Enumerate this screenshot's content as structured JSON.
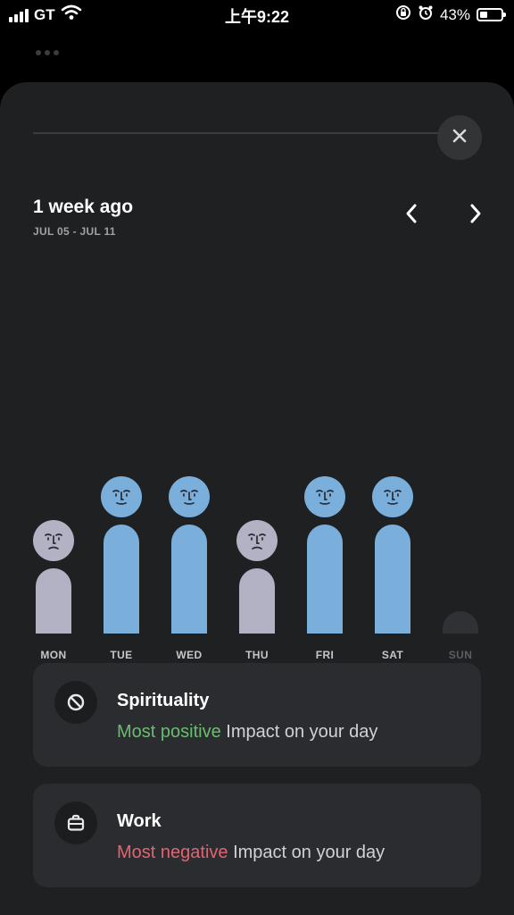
{
  "status_bar": {
    "carrier": "GT",
    "time": "上午9:22",
    "battery_percent": "43%",
    "battery_level": 0.43
  },
  "header": {
    "title": "1 week ago",
    "date_range": "JUL 05 - JUL 11"
  },
  "colors": {
    "positive_bar": "#7aaedb",
    "neutral_bar": "#b3b1c4",
    "empty_bar": "#2f3134",
    "positive_text": "#6abd6f",
    "negative_text": "#e06572"
  },
  "days": [
    {
      "label": "MON",
      "mood": "sad",
      "level": 0.6
    },
    {
      "label": "TUE",
      "mood": "happy",
      "level": 1.0
    },
    {
      "label": "WED",
      "mood": "happy",
      "level": 1.0
    },
    {
      "label": "THU",
      "mood": "sad",
      "level": 0.6
    },
    {
      "label": "FRI",
      "mood": "happy",
      "level": 1.0
    },
    {
      "label": "SAT",
      "mood": "happy",
      "level": 1.0
    },
    {
      "label": "SUN",
      "mood": "none",
      "level": 0.0
    }
  ],
  "impacts": [
    {
      "title": "Spirituality",
      "highlight": "Most positive",
      "rest": " Impact on your day",
      "icon": "spirituality-icon",
      "tone": "positive"
    },
    {
      "title": "Work",
      "highlight": "Most negative",
      "rest": " Impact on your day",
      "icon": "briefcase-icon",
      "tone": "negative"
    }
  ]
}
